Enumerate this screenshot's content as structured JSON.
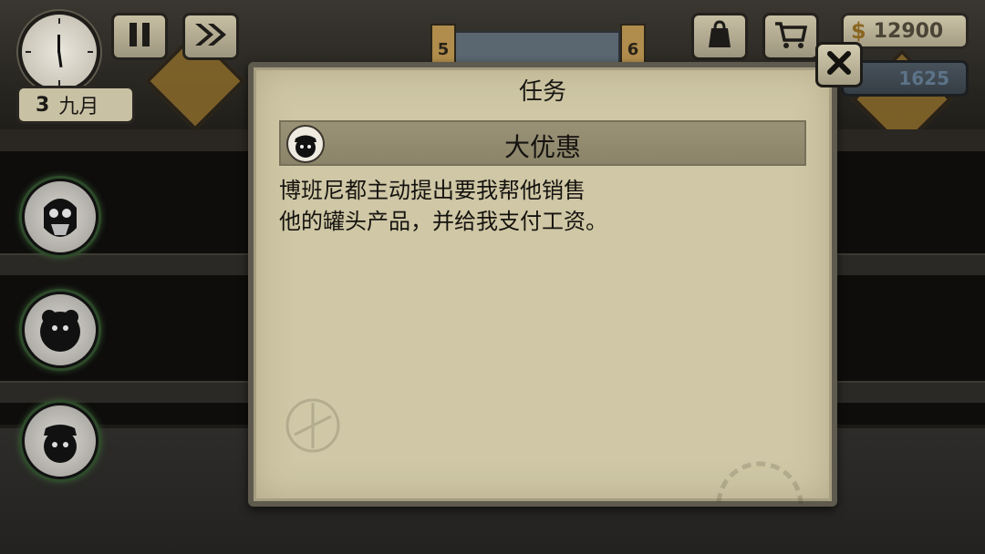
{
  "hud": {
    "date_day": "3",
    "date_month": "九月",
    "money_symbol": "$",
    "money": "12900",
    "gems": "1625"
  },
  "scene": {
    "tag_left": "5",
    "tag_right": "6"
  },
  "icons": {
    "pause": "pause-icon",
    "fast_forward": "fast-forward-icon",
    "bag": "bag-icon",
    "cart": "cart-icon",
    "close": "close-icon"
  },
  "characters": [
    "bearded-tenant-avatar",
    "fluffy-tenant-avatar",
    "capped-tenant-avatar"
  ],
  "modal": {
    "title": "任务",
    "quest_title": "大优惠",
    "quest_lines": [
      "博班尼都主动提出要我帮他销售",
      "他的罐头产品，并给我支付工资。"
    ]
  },
  "colors": {
    "panel": "#cfc7a5",
    "panel_border": "#5e5a4e",
    "quest_bar": "#8f886d",
    "avatar_glow": "#3e6b36"
  }
}
